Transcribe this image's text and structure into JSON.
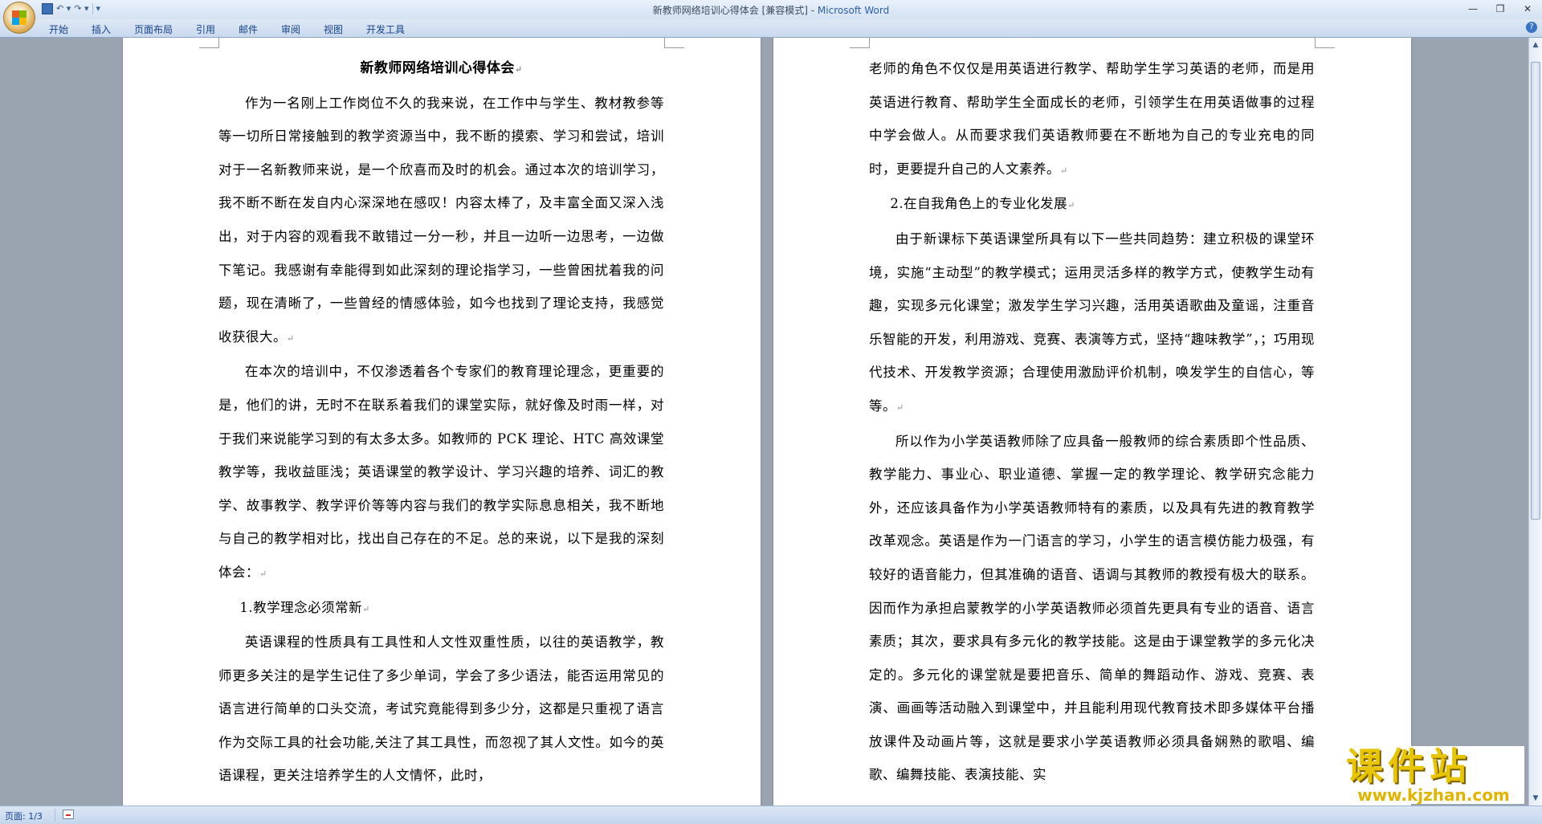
{
  "window": {
    "doc_title": "新教师网络培训心得体会 [兼容模式] - ",
    "app_name": "Microsoft Word"
  },
  "quick_access": {
    "save": "💾",
    "undo": "↶ ▾",
    "redo": "↷ ▾",
    "customize": "▾"
  },
  "window_controls": {
    "minimize": "—",
    "maximize": "❐",
    "close": "✕"
  },
  "ribbon_tabs": [
    "开始",
    "插入",
    "页面布局",
    "引用",
    "邮件",
    "审阅",
    "视图",
    "开发工具"
  ],
  "help": "?",
  "page1": {
    "title": "新教师网络培训心得体会",
    "paragraphs": [
      "作为一名刚上工作岗位不久的我来说，在工作中与学生、教材教参等等一切所日常接触到的教学资源当中，我不断的摸索、学习和尝试，培训对于一名新教师来说，是一个欣喜而及时的机会。通过本次的培训学习，我不断不断在发自内心深深地在感叹！内容太棒了，及丰富全面又深入浅出，对于内容的观看我不敢错过一分一秒，并且一边听一边思考，一边做下笔记。我感谢有幸能得到如此深刻的理论指学习，一些曾困扰着我的问题，现在清晰了，一些曾经的情感体验，如今也找到了理论支持，我感觉收获很大。",
      "在本次的培训中，不仅渗透着各个专家们的教育理论理念，更重要的是，他们的讲，无时不在联系着我们的课堂实际，就好像及时雨一样，对于我们来说能学习到的有太多太多。如教师的 PCK 理论、HTC 高效课堂教学等，我收益匪浅；英语课堂的教学设计、学习兴趣的培养、词汇的教学、故事教学、教学评价等等内容与我们的教学实际息息相关，我不断地与自己的教学相对比，找出自己存在的不足。总的来说，以下是我的深刻体会："
    ],
    "heading": "1.教学理念必须常新",
    "paragraph3": "英语课程的性质具有工具性和人文性双重性质，以往的英语教学，教师更多关注的是学生记住了多少单词，学会了多少语法，能否运用常见的语言进行简单的口头交流，考试究竟能得到多少分，这都是只重视了语言作为交际工具的社会功能,关注了其工具性，而忽视了其人文性。如今的英语课程，更关注培养学生的人文情怀，此时，"
  },
  "page2": {
    "paragraph_cont": "老师的角色不仅仅是用英语进行教学、帮助学生学习英语的老师，而是用英语进行教育、帮助学生全面成长的老师，引领学生在用英语做事的过程中学会做人。从而要求我们英语教师要在不断地为自己的专业充电的同时，更要提升自己的人文素养。",
    "heading": "2.在自我角色上的专业化发展",
    "paragraphs": [
      "由于新课标下英语课堂所具有以下一些共同趋势：建立积极的课堂环境，实施“主动型”的教学模式；运用灵活多样的教学方式，使教学生动有趣，实现多元化课堂；激发学生学习兴趣，活用英语歌曲及童谣，注重音乐智能的开发，利用游戏、竞赛、表演等方式，坚持“趣味教学”，；巧用现代技术、开发教学资源；合理使用激励评价机制，唤发学生的自信心，等等。",
      "所以作为小学英语教师除了应具备一般教师的综合素质即个性品质、教学能力、事业心、职业道德、掌握一定的教学理论、教学研究念能力外，还应该具备作为小学英语教师特有的素质，以及具有先进的教育教学改革观念。英语是作为一门语言的学习，小学生的语言模仿能力极强，有较好的语音能力，但其准确的语音、语调与其教师的教授有极大的联系。因而作为承担启蒙教学的小学英语教师必须首先更具有专业的语音、语言素质；其次，要求具有多元化的教学技能。这是由于课堂教学的多元化决定的。多元化的课堂就是要把音乐、简单的舞蹈动作、游戏、竞赛、表演、画画等活动融入到课堂中，并且能利用现代教育技术即多媒体平台播放课件及动画片等，这就是要求小学英语教师必须具备娴熟的歌唱、编歌、编舞技能、表演技能、实"
    ]
  },
  "paragraph_mark": "↵",
  "scrollbar": {
    "up": "▲",
    "down": "▼"
  },
  "status_bar": {
    "page_info": "页面: 1/3"
  },
  "watermark": {
    "brand": "课件站",
    "url": "www.kjzhan.com"
  }
}
